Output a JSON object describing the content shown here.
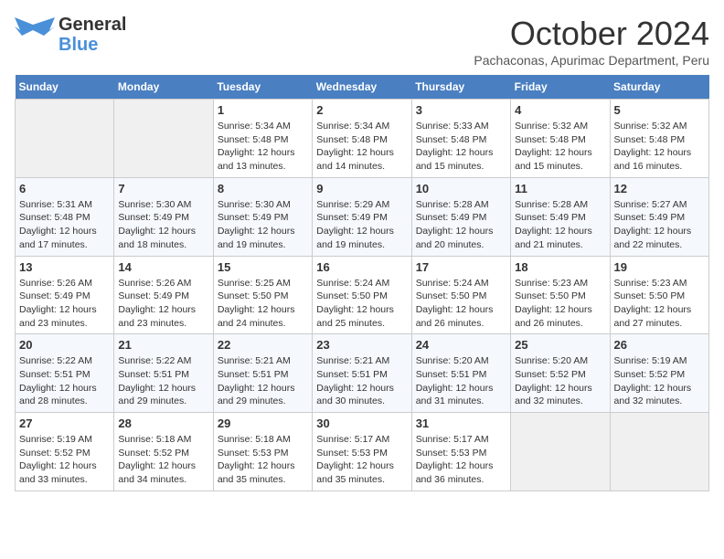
{
  "header": {
    "logo": {
      "line1": "General",
      "line2": "Blue"
    },
    "month": "October 2024",
    "location": "Pachaconas, Apurimac Department, Peru"
  },
  "days_of_week": [
    "Sunday",
    "Monday",
    "Tuesday",
    "Wednesday",
    "Thursday",
    "Friday",
    "Saturday"
  ],
  "weeks": [
    [
      {
        "day": "",
        "info": ""
      },
      {
        "day": "",
        "info": ""
      },
      {
        "day": "1",
        "sunrise": "5:34 AM",
        "sunset": "5:48 PM",
        "daylight": "12 hours and 13 minutes."
      },
      {
        "day": "2",
        "sunrise": "5:34 AM",
        "sunset": "5:48 PM",
        "daylight": "12 hours and 14 minutes."
      },
      {
        "day": "3",
        "sunrise": "5:33 AM",
        "sunset": "5:48 PM",
        "daylight": "12 hours and 15 minutes."
      },
      {
        "day": "4",
        "sunrise": "5:32 AM",
        "sunset": "5:48 PM",
        "daylight": "12 hours and 15 minutes."
      },
      {
        "day": "5",
        "sunrise": "5:32 AM",
        "sunset": "5:48 PM",
        "daylight": "12 hours and 16 minutes."
      }
    ],
    [
      {
        "day": "6",
        "sunrise": "5:31 AM",
        "sunset": "5:48 PM",
        "daylight": "12 hours and 17 minutes."
      },
      {
        "day": "7",
        "sunrise": "5:30 AM",
        "sunset": "5:49 PM",
        "daylight": "12 hours and 18 minutes."
      },
      {
        "day": "8",
        "sunrise": "5:30 AM",
        "sunset": "5:49 PM",
        "daylight": "12 hours and 19 minutes."
      },
      {
        "day": "9",
        "sunrise": "5:29 AM",
        "sunset": "5:49 PM",
        "daylight": "12 hours and 19 minutes."
      },
      {
        "day": "10",
        "sunrise": "5:28 AM",
        "sunset": "5:49 PM",
        "daylight": "12 hours and 20 minutes."
      },
      {
        "day": "11",
        "sunrise": "5:28 AM",
        "sunset": "5:49 PM",
        "daylight": "12 hours and 21 minutes."
      },
      {
        "day": "12",
        "sunrise": "5:27 AM",
        "sunset": "5:49 PM",
        "daylight": "12 hours and 22 minutes."
      }
    ],
    [
      {
        "day": "13",
        "sunrise": "5:26 AM",
        "sunset": "5:49 PM",
        "daylight": "12 hours and 23 minutes."
      },
      {
        "day": "14",
        "sunrise": "5:26 AM",
        "sunset": "5:49 PM",
        "daylight": "12 hours and 23 minutes."
      },
      {
        "day": "15",
        "sunrise": "5:25 AM",
        "sunset": "5:50 PM",
        "daylight": "12 hours and 24 minutes."
      },
      {
        "day": "16",
        "sunrise": "5:24 AM",
        "sunset": "5:50 PM",
        "daylight": "12 hours and 25 minutes."
      },
      {
        "day": "17",
        "sunrise": "5:24 AM",
        "sunset": "5:50 PM",
        "daylight": "12 hours and 26 minutes."
      },
      {
        "day": "18",
        "sunrise": "5:23 AM",
        "sunset": "5:50 PM",
        "daylight": "12 hours and 26 minutes."
      },
      {
        "day": "19",
        "sunrise": "5:23 AM",
        "sunset": "5:50 PM",
        "daylight": "12 hours and 27 minutes."
      }
    ],
    [
      {
        "day": "20",
        "sunrise": "5:22 AM",
        "sunset": "5:51 PM",
        "daylight": "12 hours and 28 minutes."
      },
      {
        "day": "21",
        "sunrise": "5:22 AM",
        "sunset": "5:51 PM",
        "daylight": "12 hours and 29 minutes."
      },
      {
        "day": "22",
        "sunrise": "5:21 AM",
        "sunset": "5:51 PM",
        "daylight": "12 hours and 29 minutes."
      },
      {
        "day": "23",
        "sunrise": "5:21 AM",
        "sunset": "5:51 PM",
        "daylight": "12 hours and 30 minutes."
      },
      {
        "day": "24",
        "sunrise": "5:20 AM",
        "sunset": "5:51 PM",
        "daylight": "12 hours and 31 minutes."
      },
      {
        "day": "25",
        "sunrise": "5:20 AM",
        "sunset": "5:52 PM",
        "daylight": "12 hours and 32 minutes."
      },
      {
        "day": "26",
        "sunrise": "5:19 AM",
        "sunset": "5:52 PM",
        "daylight": "12 hours and 32 minutes."
      }
    ],
    [
      {
        "day": "27",
        "sunrise": "5:19 AM",
        "sunset": "5:52 PM",
        "daylight": "12 hours and 33 minutes."
      },
      {
        "day": "28",
        "sunrise": "5:18 AM",
        "sunset": "5:52 PM",
        "daylight": "12 hours and 34 minutes."
      },
      {
        "day": "29",
        "sunrise": "5:18 AM",
        "sunset": "5:53 PM",
        "daylight": "12 hours and 35 minutes."
      },
      {
        "day": "30",
        "sunrise": "5:17 AM",
        "sunset": "5:53 PM",
        "daylight": "12 hours and 35 minutes."
      },
      {
        "day": "31",
        "sunrise": "5:17 AM",
        "sunset": "5:53 PM",
        "daylight": "12 hours and 36 minutes."
      },
      {
        "day": "",
        "info": ""
      },
      {
        "day": "",
        "info": ""
      }
    ]
  ],
  "labels": {
    "sunrise": "Sunrise:",
    "sunset": "Sunset:",
    "daylight": "Daylight:"
  }
}
